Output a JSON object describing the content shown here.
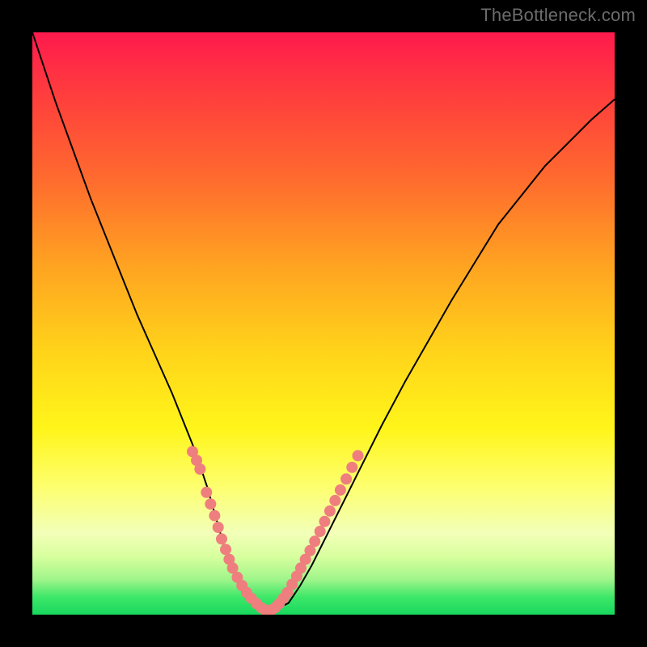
{
  "watermark": "TheBottleneck.com",
  "chart_data": {
    "type": "line",
    "title": "",
    "xlabel": "",
    "ylabel": "",
    "xlim": [
      0,
      100
    ],
    "ylim": [
      0,
      100
    ],
    "grid": false,
    "background_gradient_stops": [
      {
        "pos": 0,
        "color": "#ff1a4d"
      },
      {
        "pos": 10,
        "color": "#ff3b3e"
      },
      {
        "pos": 25,
        "color": "#ff6a2e"
      },
      {
        "pos": 40,
        "color": "#ffa321"
      },
      {
        "pos": 55,
        "color": "#ffd41a"
      },
      {
        "pos": 68,
        "color": "#fff51a"
      },
      {
        "pos": 78,
        "color": "#fdff6e"
      },
      {
        "pos": 86,
        "color": "#f2ffb8"
      },
      {
        "pos": 90,
        "color": "#d8ff9e"
      },
      {
        "pos": 94,
        "color": "#9ef58a"
      },
      {
        "pos": 97,
        "color": "#3de768"
      },
      {
        "pos": 100,
        "color": "#18d85e"
      }
    ],
    "series": [
      {
        "name": "bottleneck-curve",
        "color": "#000000",
        "stroke_width": 2,
        "x": [
          0,
          2,
          4,
          6,
          8,
          10,
          12,
          14,
          16,
          18,
          20,
          22,
          24,
          26,
          28,
          30,
          31,
          32,
          33,
          34,
          35,
          36,
          37,
          38,
          39,
          40,
          41,
          42,
          44,
          46,
          48,
          50,
          52,
          54,
          56,
          58,
          60,
          64,
          68,
          72,
          76,
          80,
          84,
          88,
          92,
          96,
          100
        ],
        "y": [
          100,
          94,
          88,
          82.5,
          77,
          71.5,
          66.5,
          61.5,
          56.5,
          51.5,
          47,
          42.5,
          38,
          33,
          28,
          22,
          18.5,
          15,
          11.5,
          8.5,
          6,
          4,
          2.5,
          1.5,
          1,
          0.5,
          0.5,
          1,
          2,
          5,
          8.5,
          12.5,
          16.5,
          20.5,
          24.5,
          28.5,
          32.5,
          40,
          47,
          54,
          60.5,
          67,
          72,
          77,
          81,
          85,
          88.5
        ]
      },
      {
        "name": "points-left-branch",
        "color": "#ee7f7e",
        "type": "scatter",
        "marker_size": 14,
        "x": [
          27.5,
          28.2,
          28.8,
          29.9,
          30.6,
          31.3,
          31.9,
          32.5,
          33.2,
          33.8,
          34.4,
          35.2,
          36.0,
          36.8,
          37.6,
          38.5,
          39.3,
          40.0
        ],
        "y": [
          28,
          26.5,
          25,
          21,
          19,
          17,
          15,
          13,
          11.2,
          9.5,
          8,
          6.4,
          5,
          3.8,
          2.8,
          1.9,
          1.2,
          0.8
        ]
      },
      {
        "name": "points-right-branch",
        "color": "#ee7f7e",
        "type": "scatter",
        "marker_size": 14,
        "x": [
          41.0,
          41.7,
          42.4,
          43.1,
          43.8,
          44.6,
          45.4,
          46.1,
          46.9,
          47.7,
          48.5,
          49.4,
          50.2,
          51.1,
          52.0,
          52.9,
          53.9,
          54.9,
          55.9
        ],
        "y": [
          0.8,
          1.2,
          1.9,
          2.8,
          3.8,
          5.2,
          6.6,
          8,
          9.5,
          11,
          12.6,
          14.3,
          16,
          17.8,
          19.6,
          21.4,
          23.3,
          25.3,
          27.3
        ]
      }
    ],
    "curve_minimum": {
      "x": 40,
      "y": 0.5
    }
  }
}
